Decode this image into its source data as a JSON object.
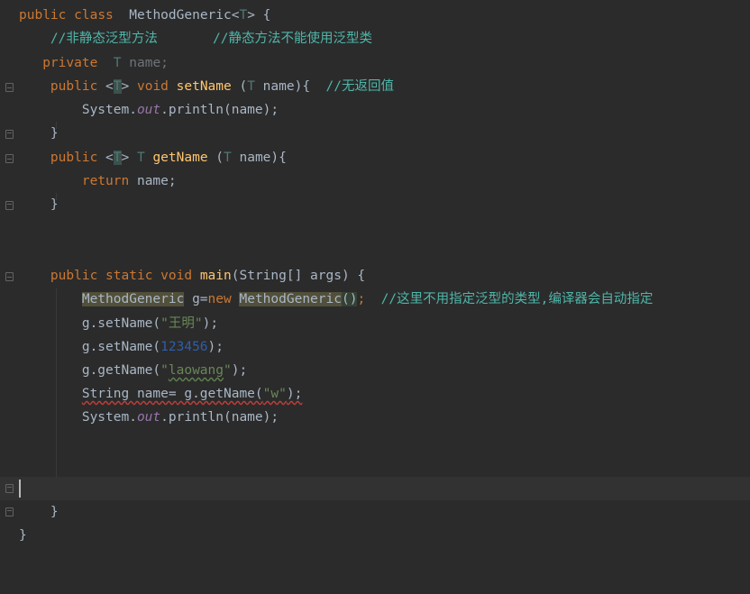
{
  "lines": {
    "l1": {
      "kw1": "public",
      "kw2": "class",
      "name": "MethodGeneric",
      "tp": "T",
      "brace": " {"
    },
    "l2": {
      "c1": "//非静态泛型方法",
      "c2": "//静态方法不能使用泛型类"
    },
    "l3": {
      "kw": "private",
      "tp": "T",
      "field": "name",
      "semi": ";"
    },
    "l4": {
      "kw": "public",
      "lt": "<",
      "tp": "T",
      "gt": ">",
      "void": "void",
      "fn": "setName",
      "params1": " (",
      "ptp": "T",
      "params2": " name){",
      "comment": "//无返回值"
    },
    "l5": {
      "sys": "System.",
      "out": "out",
      "rest": ".println(name);"
    },
    "l6": {
      "brace": "}"
    },
    "l7": {
      "kw": "public",
      "lt": "<",
      "tp": "T",
      "gt": ">",
      "rtp": "T",
      "fn": "getName",
      "params1": " (",
      "ptp": "T",
      "params2": " name){"
    },
    "l8": {
      "kw": "return",
      "rest": " name;"
    },
    "l9": {
      "brace": "}"
    },
    "l12": {
      "kw1": "public",
      "kw2": "static",
      "kw3": "void",
      "fn": "main",
      "rest": "(String[] args) {"
    },
    "l13": {
      "t1": "MethodGeneric",
      "sp": " g=",
      "kw": "new",
      "sp2": " ",
      "t2": "MethodGeneric",
      "paren": "()",
      "semi": ";",
      "comment": "//这里不用指定泛型的类型,编译器会自动指定"
    },
    "l14": {
      "pre": "g.setName(",
      "str": "\"王明\"",
      "post": ");"
    },
    "l15": {
      "pre": "g.setName(",
      "num": "123456",
      "post": ");"
    },
    "l16": {
      "pre": "g.getName(",
      "q1": "\"",
      "str": "laowang",
      "q2": "\"",
      "post": ");"
    },
    "l17": {
      "err": "String name=",
      "sp": " g.getName(",
      "str": "\"w\"",
      "post": ");"
    },
    "l18": {
      "sys": "System.",
      "out": "out",
      "rest": ".println(name);"
    },
    "l22": {
      "brace": "}"
    },
    "l23": {
      "brace": "}"
    }
  }
}
